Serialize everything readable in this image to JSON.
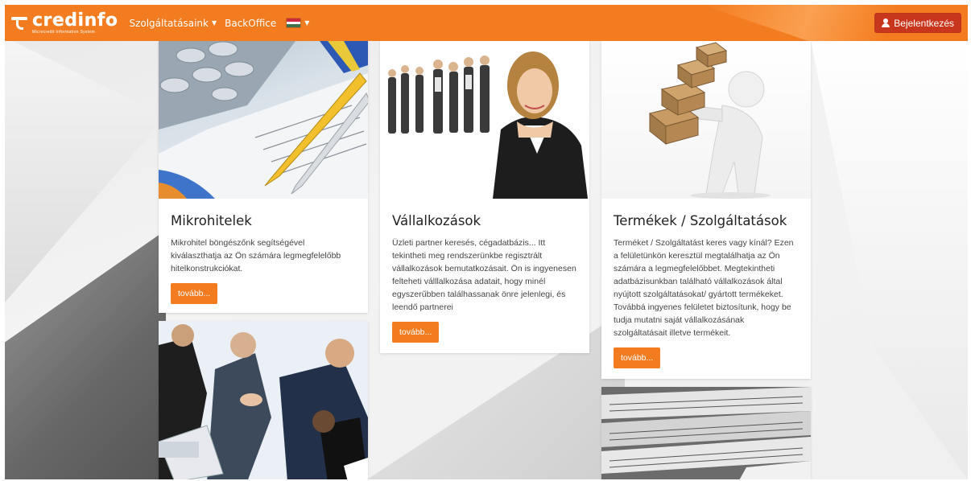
{
  "navbar": {
    "brand_name": "credinfo",
    "brand_tagline": "Microcredit Information System",
    "services_label": "Szolgáltatásaink",
    "backoffice_label": "BackOffice",
    "login_label": "Bejelentkezés",
    "colors": {
      "bar": "#f47c20",
      "login": "#c8361d"
    }
  },
  "cards": [
    {
      "title": "Mikrohitelek",
      "text": "Mikrohitel böngészőnk segítségével kiválaszthatja az Ön számára legmegfelelőbb hitelkonstrukciókat.",
      "button": "tovább..."
    },
    {
      "title": "Vállalkozások",
      "text": "Üzleti partner keresés, cégadatbázis... Itt tekintheti meg rendszerünkbe regisztrált vállalkozások bemutatkozásait. Ön is ingyenesen felteheti válllalkozása adatait, hogy minél egyszerűbben találhassanak önre jelenlegi, és leendő partnerei",
      "button": "tovább..."
    },
    {
      "title": "Termékek / Szolgáltatások",
      "text": "Terméket / Szolgáltatást keres vagy kínál? Ezen a felületünkön keresztül megtalálhatja az Ön számára a legmegfelelőbbet. Megtekintheti adatbázisunkban található vállalkozások által nyújtott szolgáltatásokat/ gyártott termékeket. Továbbá ingyenes felületet biztosítunk, hogy be tudja mutatni saját vállalkozásának szolgáltatásait illetve termékeit.",
      "button": "tovább..."
    }
  ],
  "accent_color": "#f47c20"
}
